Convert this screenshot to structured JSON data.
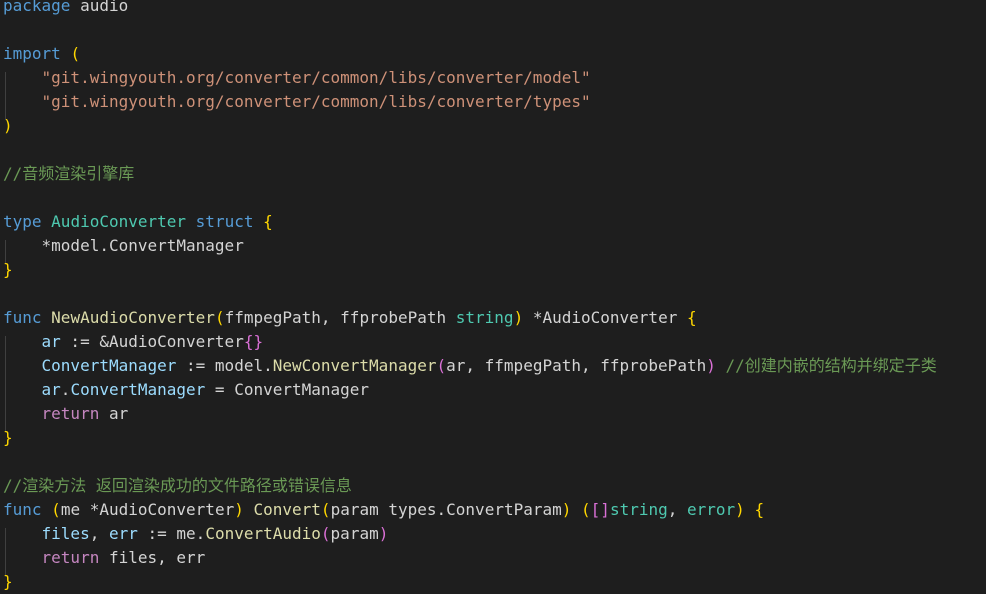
{
  "colors": {
    "background": "#1e1e1e",
    "kw": "#569cd6",
    "ctrl": "#c586c0",
    "str": "#ce9178",
    "com": "#6a9955",
    "type": "#4ec9b0",
    "fn": "#dcdcaa",
    "var": "#9cdcfe",
    "txt": "#d4d4d4",
    "b1": "#ffd700",
    "b2": "#da70d6",
    "b3": "#179fff"
  },
  "editor": {
    "lines": [
      {
        "tokens": [
          [
            "package",
            "kw"
          ],
          [
            " audio",
            "txt"
          ]
        ]
      },
      {
        "tokens": []
      },
      {
        "tokens": [
          [
            "import",
            "kw"
          ],
          [
            " ",
            "txt"
          ],
          [
            "(",
            "b1"
          ]
        ]
      },
      {
        "tokens": [
          [
            "    ",
            "txt"
          ],
          [
            "\"git.wingyouth.org/converter/common/libs/converter/model\"",
            "str"
          ]
        ]
      },
      {
        "tokens": [
          [
            "    ",
            "txt"
          ],
          [
            "\"git.wingyouth.org/converter/common/libs/converter/types\"",
            "str"
          ]
        ]
      },
      {
        "tokens": [
          [
            ")",
            "b1"
          ]
        ]
      },
      {
        "tokens": []
      },
      {
        "tokens": [
          [
            "//音频渲染引擎库",
            "com"
          ]
        ]
      },
      {
        "tokens": []
      },
      {
        "tokens": [
          [
            "type",
            "kw"
          ],
          [
            " ",
            "txt"
          ],
          [
            "AudioConverter",
            "type"
          ],
          [
            " ",
            "txt"
          ],
          [
            "struct",
            "kw"
          ],
          [
            " ",
            "txt"
          ],
          [
            "{",
            "b1"
          ]
        ]
      },
      {
        "tokens": [
          [
            "    *model.ConvertManager",
            "txt"
          ]
        ]
      },
      {
        "tokens": [
          [
            "}",
            "b1"
          ]
        ]
      },
      {
        "tokens": []
      },
      {
        "tokens": [
          [
            "func",
            "kw"
          ],
          [
            " ",
            "txt"
          ],
          [
            "NewAudioConverter",
            "fn"
          ],
          [
            "(",
            "b1"
          ],
          [
            "ffmpegPath, ffprobePath ",
            "txt"
          ],
          [
            "string",
            "type"
          ],
          [
            ")",
            "b1"
          ],
          [
            " *AudioConverter ",
            "txt"
          ],
          [
            "{",
            "b1"
          ]
        ]
      },
      {
        "tokens": [
          [
            "    ",
            "txt"
          ],
          [
            "ar",
            "var"
          ],
          [
            " := &AudioConverter",
            "txt"
          ],
          [
            "{}",
            "b2"
          ]
        ]
      },
      {
        "tokens": [
          [
            "    ",
            "txt"
          ],
          [
            "ConvertManager",
            "var"
          ],
          [
            " := model.",
            "txt"
          ],
          [
            "NewConvertManager",
            "fn"
          ],
          [
            "(",
            "b2"
          ],
          [
            "ar, ffmpegPath, ffprobePath",
            "txt"
          ],
          [
            ")",
            "b2"
          ],
          [
            " ",
            "txt"
          ],
          [
            "//创建内嵌的结构并绑定子类",
            "com"
          ]
        ]
      },
      {
        "tokens": [
          [
            "    ",
            "txt"
          ],
          [
            "ar",
            "var"
          ],
          [
            ".",
            "txt"
          ],
          [
            "ConvertManager",
            "var"
          ],
          [
            " = ConvertManager",
            "txt"
          ]
        ]
      },
      {
        "tokens": [
          [
            "    ",
            "txt"
          ],
          [
            "return",
            "ctrl"
          ],
          [
            " ar",
            "txt"
          ]
        ]
      },
      {
        "tokens": [
          [
            "}",
            "b1"
          ]
        ]
      },
      {
        "tokens": []
      },
      {
        "tokens": [
          [
            "//渲染方法 返回渲染成功的文件路径或错误信息",
            "com"
          ]
        ]
      },
      {
        "tokens": [
          [
            "func",
            "kw"
          ],
          [
            " ",
            "txt"
          ],
          [
            "(",
            "b1"
          ],
          [
            "me *AudioConverter",
            "txt"
          ],
          [
            ")",
            "b1"
          ],
          [
            " ",
            "txt"
          ],
          [
            "Convert",
            "fn"
          ],
          [
            "(",
            "b1"
          ],
          [
            "param types.ConvertParam",
            "txt"
          ],
          [
            ")",
            "b1"
          ],
          [
            " ",
            "txt"
          ],
          [
            "(",
            "b1"
          ],
          [
            "[]",
            "b2"
          ],
          [
            "string",
            "type"
          ],
          [
            ", ",
            "txt"
          ],
          [
            "error",
            "type"
          ],
          [
            ")",
            "b1"
          ],
          [
            " ",
            "txt"
          ],
          [
            "{",
            "b1"
          ]
        ]
      },
      {
        "tokens": [
          [
            "    ",
            "txt"
          ],
          [
            "files",
            "var"
          ],
          [
            ", ",
            "txt"
          ],
          [
            "err",
            "var"
          ],
          [
            " := me.",
            "txt"
          ],
          [
            "ConvertAudio",
            "fn"
          ],
          [
            "(",
            "b2"
          ],
          [
            "param",
            "txt"
          ],
          [
            ")",
            "b2"
          ]
        ]
      },
      {
        "tokens": [
          [
            "    ",
            "txt"
          ],
          [
            "return",
            "ctrl"
          ],
          [
            " files, err",
            "txt"
          ]
        ]
      },
      {
        "tokens": [
          [
            "}",
            "b1"
          ]
        ]
      }
    ]
  }
}
